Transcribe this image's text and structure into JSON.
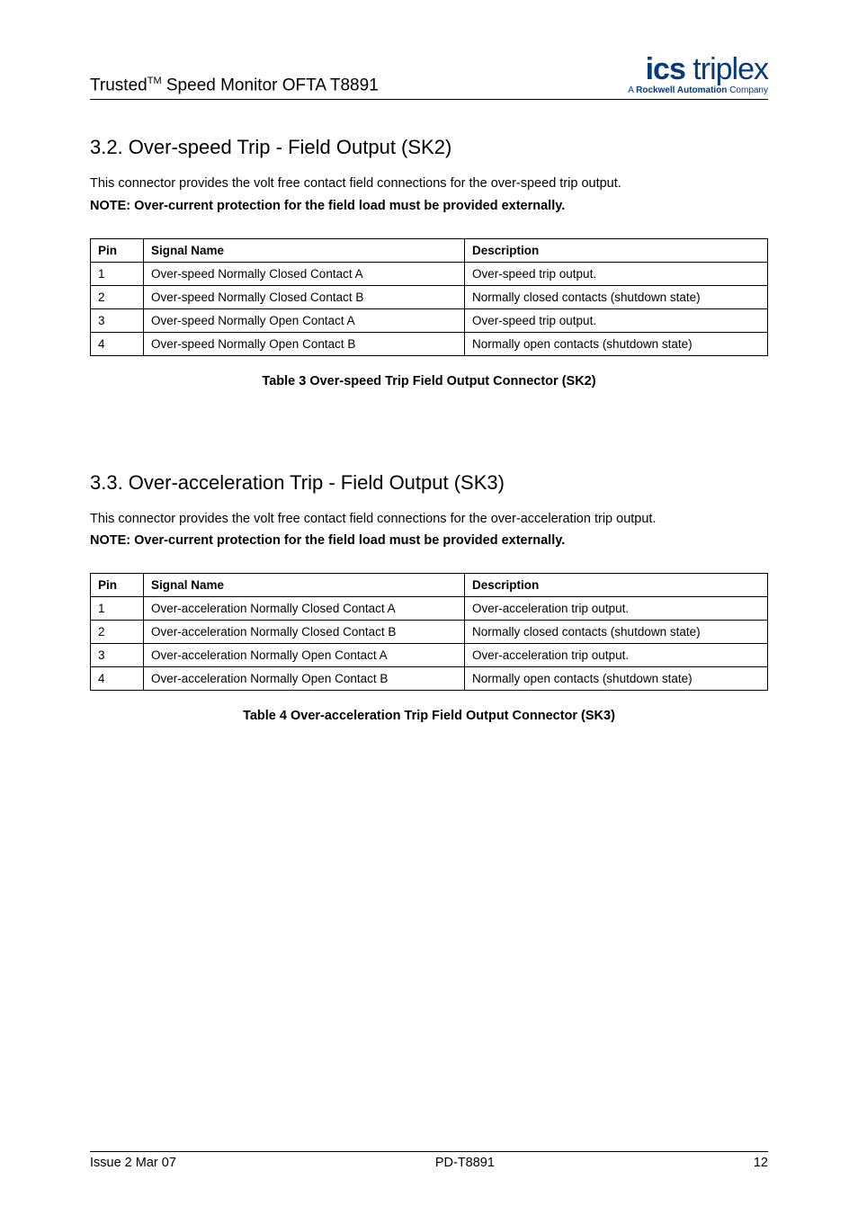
{
  "header": {
    "title_prefix": "Trusted",
    "title_tm": "TM",
    "title_rest": " Speed Monitor OFTA T8891",
    "logo_bold": "ics",
    "logo_light": " triplex",
    "logo_sub_prefix": "A ",
    "logo_sub_bold": "Rockwell Automation",
    "logo_sub_suffix": " Company"
  },
  "section32": {
    "heading": "3.2. Over-speed Trip - Field Output (SK2)",
    "intro": "This connector provides the volt free contact field connections for the over-speed trip output.",
    "note": "NOTE: Over-current protection for the field load must be provided externally.",
    "columns": {
      "pin": "Pin",
      "signal": "Signal Name",
      "desc": "Description"
    },
    "rows": [
      {
        "pin": "1",
        "signal": "Over-speed Normally Closed Contact A",
        "desc": "Over-speed trip output."
      },
      {
        "pin": "2",
        "signal": "Over-speed Normally Closed Contact B",
        "desc": "Normally closed contacts (shutdown state)"
      },
      {
        "pin": "3",
        "signal": "Over-speed Normally Open Contact A",
        "desc": "Over-speed trip output."
      },
      {
        "pin": "4",
        "signal": "Over-speed Normally Open Contact B",
        "desc": "Normally open contacts (shutdown state)"
      }
    ],
    "caption": "Table 3 Over-speed Trip Field Output Connector (SK2)"
  },
  "section33": {
    "heading": "3.3. Over-acceleration Trip - Field Output (SK3)",
    "intro": "This connector provides the volt free contact field connections for the over-acceleration trip output.",
    "note": "NOTE: Over-current protection for the field load must be provided externally.",
    "columns": {
      "pin": "Pin",
      "signal": "Signal Name",
      "desc": "Description"
    },
    "rows": [
      {
        "pin": "1",
        "signal": "Over-acceleration Normally Closed Contact A",
        "desc": "Over-acceleration trip output."
      },
      {
        "pin": "2",
        "signal": "Over-acceleration Normally Closed Contact B",
        "desc": "Normally closed contacts (shutdown state)"
      },
      {
        "pin": "3",
        "signal": "Over-acceleration Normally Open Contact A",
        "desc": "Over-acceleration trip output."
      },
      {
        "pin": "4",
        "signal": "Over-acceleration Normally Open Contact B",
        "desc": "Normally open contacts (shutdown state)"
      }
    ],
    "caption": "Table 4 Over-acceleration Trip Field Output Connector (SK3)"
  },
  "footer": {
    "left": "Issue 2 Mar 07",
    "center": "PD-T8891",
    "right": "12"
  }
}
